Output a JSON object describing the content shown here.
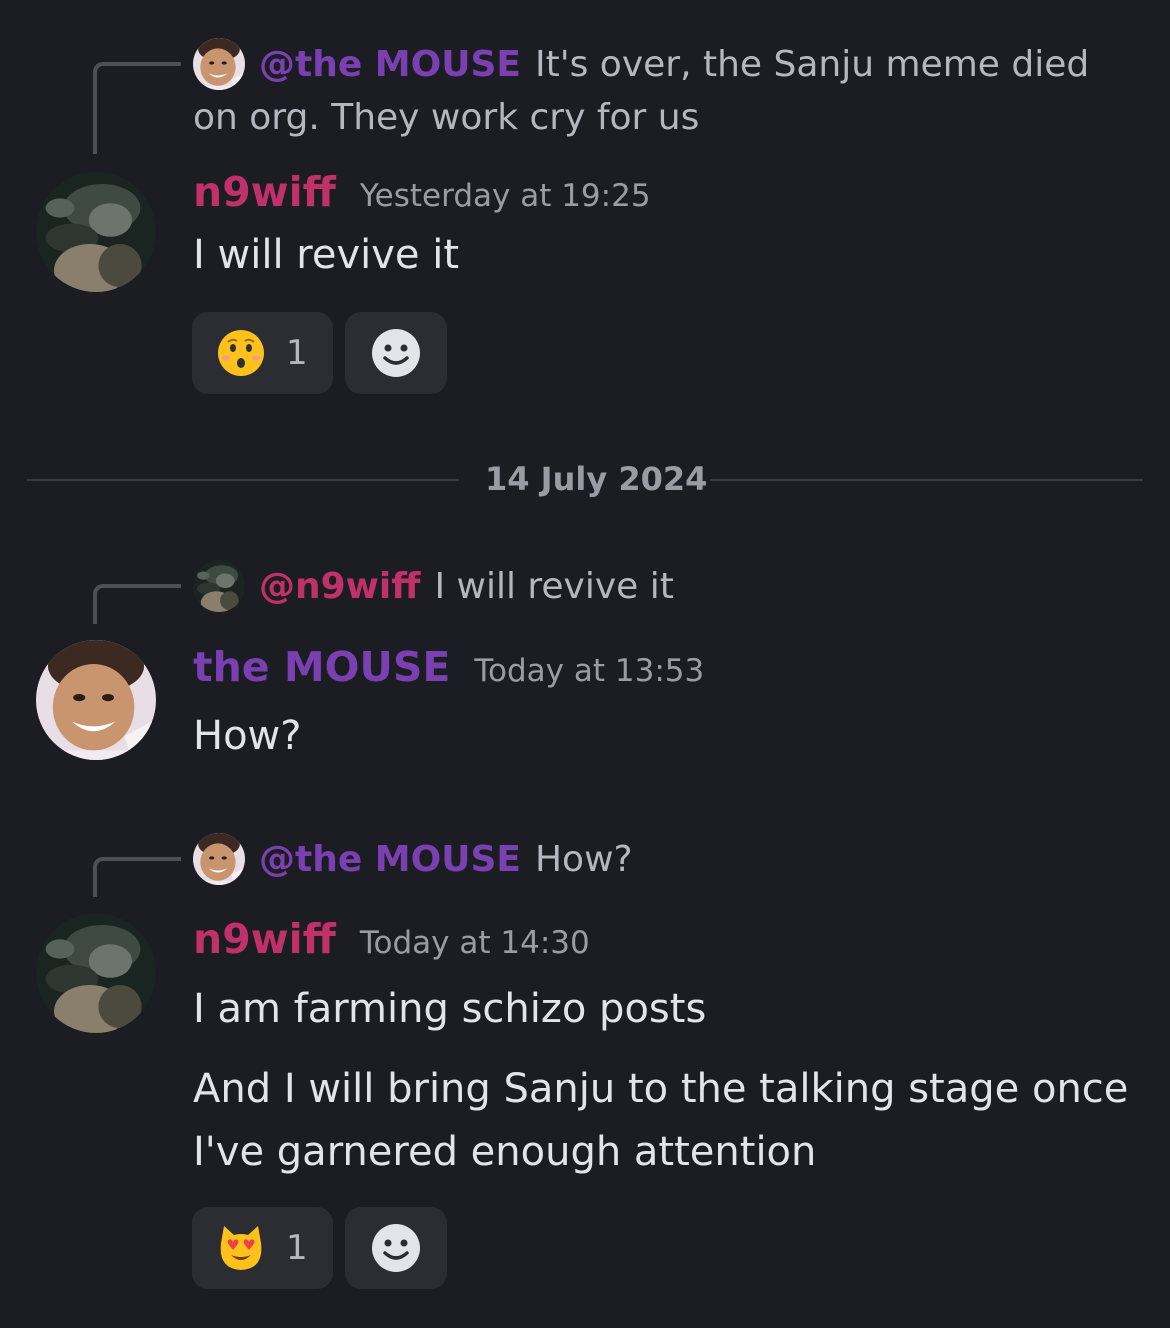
{
  "date_divider": "14 July 2024",
  "colors": {
    "the_mouse": "#7a3fb0",
    "n9wiff": "#c0306a",
    "background": "#1c1d22"
  },
  "messages": [
    {
      "reply": {
        "mention": "@the MOUSE",
        "text": "It's over, the Sanju meme died on org. They work cry for us"
      },
      "author": "n9wiff",
      "time": "Yesterday at 19:25",
      "lines": [
        "I will revive it"
      ],
      "reaction": {
        "emoji": "hushed-face",
        "count": "1"
      }
    },
    {
      "reply": {
        "mention": "@n9wiff",
        "text": "I will revive it"
      },
      "author": "the MOUSE",
      "time": "Today at 13:53",
      "lines": [
        "How?"
      ]
    },
    {
      "reply": {
        "mention": "@the MOUSE",
        "text": "How?"
      },
      "author": "n9wiff",
      "time": "Today at 14:30",
      "lines": [
        "I am farming schizo posts",
        "And I will bring Sanju to the talking stage once I've garnered enough attention"
      ],
      "reaction": {
        "emoji": "heart-eyes-cat",
        "count": "1"
      }
    }
  ]
}
